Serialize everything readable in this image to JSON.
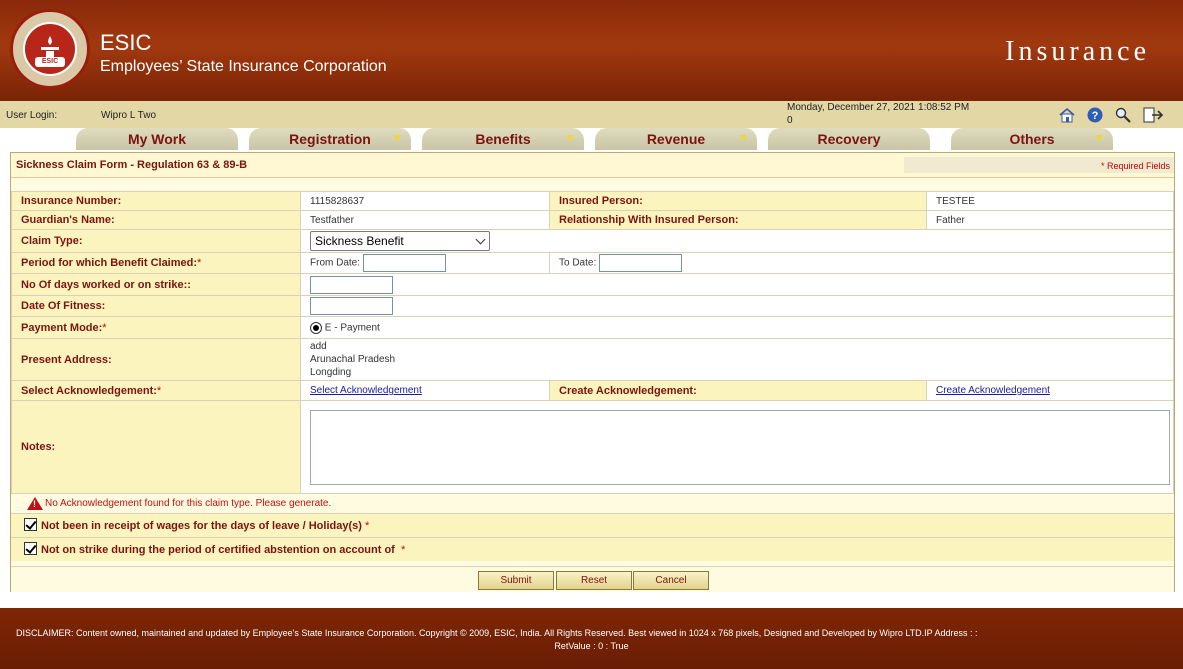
{
  "header": {
    "logo_text": "ESIC",
    "title": "ESIC",
    "subtitle": "Employees’ State Insurance Corporation",
    "right_title": "Insurance"
  },
  "infobar": {
    "user_login_label": "User Login:",
    "user_name": "Wipro L Two",
    "datetime": "Monday, December 27, 2021 1:08:52 PM",
    "counter": "0",
    "tool_icons": [
      "home-icon",
      "help-icon",
      "search-icon",
      "logout-icon"
    ]
  },
  "menu": {
    "items": [
      {
        "label": "My Work",
        "has_dropdown": false
      },
      {
        "label": "Registration",
        "has_dropdown": true
      },
      {
        "label": "Benefits",
        "has_dropdown": true
      },
      {
        "label": "Revenue",
        "has_dropdown": true
      },
      {
        "label": "Recovery",
        "has_dropdown": false
      },
      {
        "label": "Others",
        "has_dropdown": true
      }
    ]
  },
  "form": {
    "title": "Sickness Claim Form - Regulation 63 & 89-B",
    "required_note": "* Required Fields",
    "insurance_number_label": "Insurance Number:",
    "insurance_number": "1115828637",
    "insured_person_label": "Insured Person:",
    "insured_person": "TESTEE",
    "guardian_label": "Guardian's Name:",
    "guardian": "Testfather",
    "relationship_label": "Relationship With Insured Person:",
    "relationship": "Father",
    "claim_type_label": "Claim Type:",
    "claim_type_value": "Sickness Benefit",
    "period_label": "Period for which Benefit Claimed:",
    "from_date_label": "From Date:",
    "from_date_value": "",
    "to_date_label": "To Date:",
    "to_date_value": "",
    "days_worked_label": "No Of days worked or on strike::",
    "days_worked_value": "",
    "date_fitness_label": "Date Of Fitness:",
    "date_fitness_value": "",
    "payment_mode_label": "Payment Mode:",
    "payment_mode_value": "E - Payment",
    "address_label": "Present Address:",
    "address_line1": "add",
    "address_line2": "Arunachal Pradesh",
    "address_line3": "Longding",
    "select_ack_label": "Select Acknowledgement:",
    "select_ack_link": "Select Acknowledgement",
    "create_ack_label": "Create Acknowledgement:",
    "create_ack_link": "Create Acknowledgement",
    "notes_label": "Notes:",
    "notes_value": "",
    "warning": "No Acknowledgement found for this claim type. Please generate.",
    "check1": "Not been in receipt of wages for the days of leave / Holiday(s)",
    "check2": "Not on strike during the period of certified abstention on account of",
    "required_star": "*",
    "buttons": {
      "submit": "Submit",
      "reset": "Reset",
      "cancel": "Cancel"
    }
  },
  "footer": {
    "line1": "DISCLAIMER: Content owned, maintained and updated by Employee's State Insurance Corporation. Copyright © 2009, ESIC, India. All Rights Reserved. Best viewed in 1024 x 768 pixels, Designed and Developed by Wipro LTD.IP Address :          :",
    "line2": "RetValue : 0 : True"
  },
  "colors": {
    "header_bg": "#a1390f",
    "accent_text": "#7b1410",
    "form_label_bg": "#fcf4bf",
    "warning": "#c41010"
  }
}
